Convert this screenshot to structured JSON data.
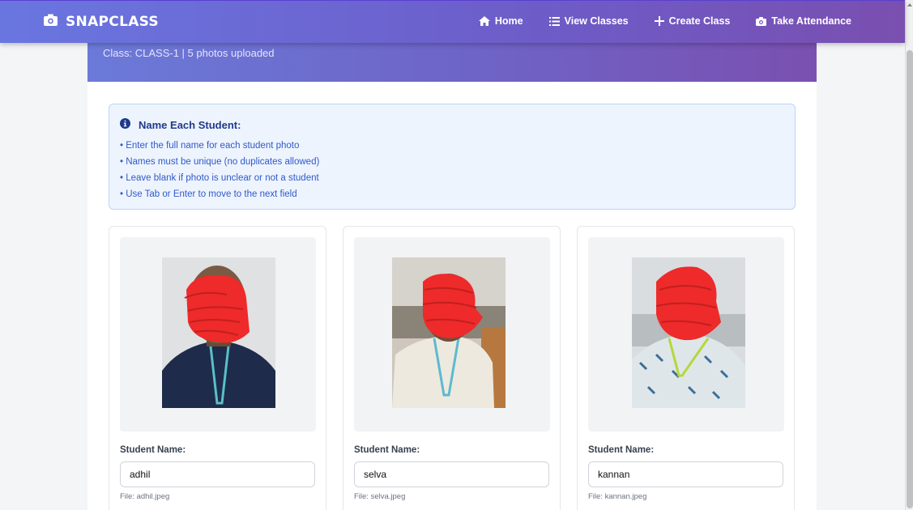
{
  "navbar": {
    "brand": "SNAPCLASS",
    "links": [
      {
        "label": "Home",
        "icon": "home-icon"
      },
      {
        "label": "View Classes",
        "icon": "list-icon"
      },
      {
        "label": "Create Class",
        "icon": "plus-icon"
      },
      {
        "label": "Take Attendance",
        "icon": "camera-icon"
      }
    ]
  },
  "banner": {
    "subtitle": "Class: CLASS-1 | 5 photos uploaded"
  },
  "info": {
    "title": "Name Each Student:",
    "items": [
      "• Enter the full name for each student photo",
      "• Names must be unique (no duplicates allowed)",
      "• Leave blank if photo is unclear or not a student",
      "• Use Tab or Enter to move to the next field"
    ]
  },
  "students": [
    {
      "label": "Student Name:",
      "value": "adhil",
      "file": "File: adhil.jpeg"
    },
    {
      "label": "Student Name:",
      "value": "selva",
      "file": "File: selva.jpeg"
    },
    {
      "label": "Student Name:",
      "value": "kannan",
      "file": "File: kannan.jpeg"
    }
  ],
  "colors": {
    "nav_gradient_start": "#6a76e0",
    "nav_gradient_end": "#7a4fb0",
    "info_bg": "#eef4fe",
    "info_text": "#2f59c9",
    "redaction": "#ee2a2a"
  }
}
